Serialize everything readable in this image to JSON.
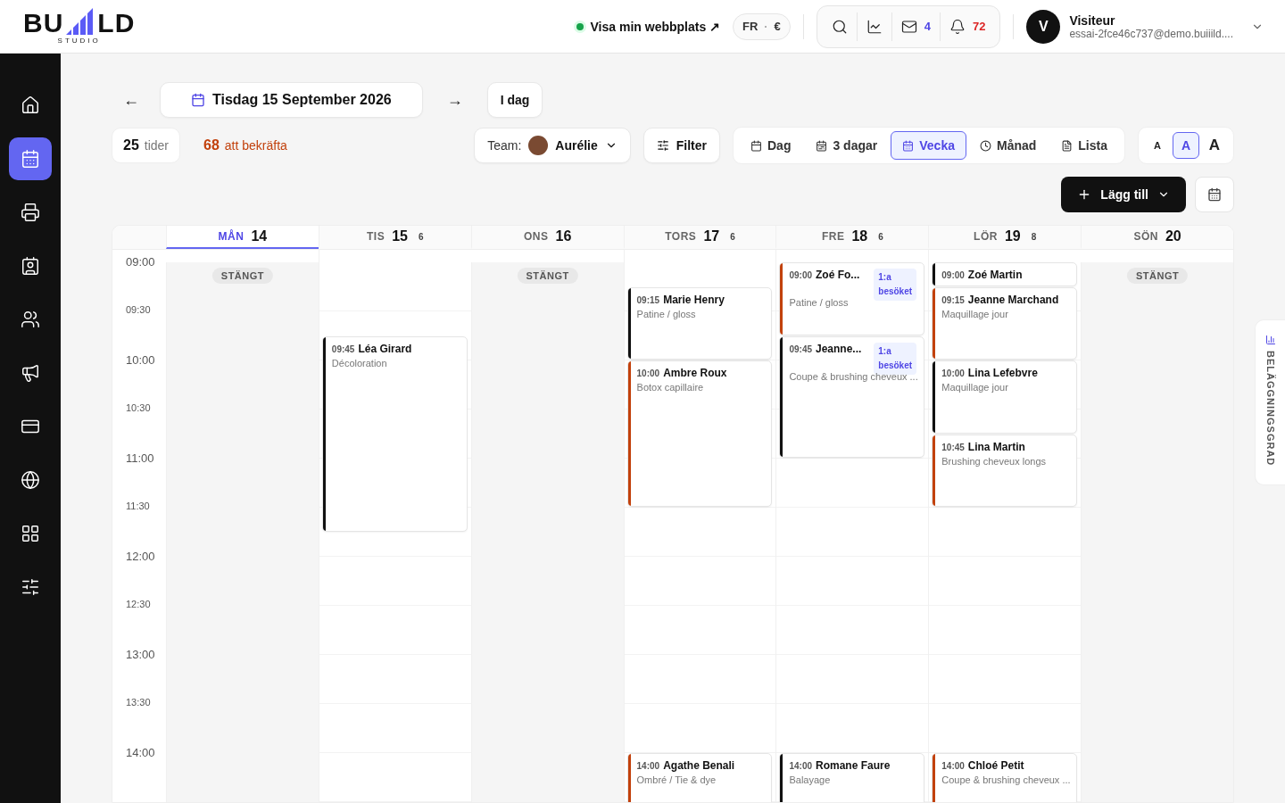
{
  "header": {
    "logo": {
      "left": "BU",
      "right": "LD",
      "sub": "STUDIO"
    },
    "site_link": {
      "label": "Visa min webbplats ↗",
      "online": true
    },
    "locale": {
      "language": "FR",
      "currency": "€"
    },
    "tools": [
      {
        "kind": "search"
      },
      {
        "kind": "stats"
      },
      {
        "kind": "mail",
        "count": "4"
      },
      {
        "kind": "bell",
        "count": "72"
      }
    ],
    "user": {
      "initial": "V",
      "name": "Visiteur",
      "email": "essai-2fce46c737@demo.buiiild...."
    }
  },
  "sidebar": {
    "items": [
      {
        "kind": "home",
        "selected": false
      },
      {
        "kind": "calendar",
        "selected": true
      },
      {
        "kind": "register",
        "selected": false
      },
      {
        "kind": "contacts",
        "selected": false
      },
      {
        "kind": "users",
        "selected": false
      },
      {
        "kind": "megaphone",
        "selected": false
      },
      {
        "kind": "card",
        "selected": false
      },
      {
        "kind": "globe",
        "selected": false
      },
      {
        "kind": "apps",
        "selected": false
      },
      {
        "kind": "sliders",
        "selected": false
      }
    ]
  },
  "date_nav": {
    "prev": "←",
    "date": "Tisdag 15 September 2026",
    "next": "→",
    "today": "I dag"
  },
  "stats": {
    "bookings": {
      "count": "25",
      "label": "tider"
    },
    "pending": {
      "count": "68",
      "label": "att bekräfta"
    }
  },
  "team": {
    "label": "Team:",
    "member": "Aurélie"
  },
  "filter": "Filter",
  "views": [
    {
      "kind": "day",
      "label": "Dag",
      "selected": false
    },
    {
      "kind": "three",
      "label": "3 dagar",
      "selected": false
    },
    {
      "kind": "week",
      "label": "Vecka",
      "selected": true
    },
    {
      "kind": "month",
      "label": "Månad",
      "selected": false
    },
    {
      "kind": "list",
      "label": "Lista",
      "selected": false
    }
  ],
  "font_sizes": [
    {
      "label": "A",
      "selected": false
    },
    {
      "label": "A",
      "selected": true
    },
    {
      "label": "A",
      "selected": false
    }
  ],
  "add_button": "Lägg till",
  "side_tab": "BELÄGGNINGSGRAD",
  "calendar": {
    "times": [
      "09:00",
      "09:30",
      "10:00",
      "10:30",
      "11:00",
      "11:30",
      "12:00",
      "12:30",
      "13:00",
      "13:30",
      "14:00"
    ],
    "days": [
      {
        "dow": "MÅN",
        "date": "14",
        "selected": true,
        "closed": true,
        "closed_label": "STÄNGT"
      },
      {
        "dow": "TIS",
        "date": "15",
        "count": "6",
        "selected": false,
        "closed": false,
        "events": [
          {
            "time": "09:45",
            "name": "Léa Girard",
            "service": "Décoloration",
            "color": "#111111"
          }
        ]
      },
      {
        "dow": "ONS",
        "date": "16",
        "selected": false,
        "closed": true,
        "closed_label": "STÄNGT"
      },
      {
        "dow": "TORS",
        "date": "17",
        "count": "6",
        "selected": false,
        "closed": false,
        "events": [
          {
            "time": "09:15",
            "name": "Marie Henry",
            "service": "Patine / gloss",
            "color": "#111111"
          },
          {
            "time": "10:00",
            "name": "Ambre Roux",
            "service": "Botox capillaire",
            "color": "#c2410c"
          },
          {
            "time": "14:00",
            "name": "Agathe Benali",
            "service": "Ombré / Tie & dye",
            "color": "#c2410c"
          }
        ]
      },
      {
        "dow": "FRE",
        "date": "18",
        "count": "6",
        "selected": false,
        "closed": false,
        "events": [
          {
            "time": "09:00",
            "name": "Zoé Fo...",
            "service": "Patine / gloss",
            "color": "#c2410c",
            "badge": "1:a besöket"
          },
          {
            "time": "09:45",
            "name": "Jeanne...",
            "service": "Coupe & brushing cheveux ...",
            "color": "#111111",
            "badge": "1:a besöket"
          },
          {
            "time": "14:00",
            "name": "Romane Faure",
            "service": "Balayage",
            "color": "#111111"
          }
        ]
      },
      {
        "dow": "LÖR",
        "date": "19",
        "count": "8",
        "selected": false,
        "closed": false,
        "events": [
          {
            "time": "09:00",
            "name": "Zoé Martin",
            "color": "#111111"
          },
          {
            "time": "09:15",
            "name": "Jeanne Marchand",
            "service": "Maquillage jour",
            "color": "#c2410c"
          },
          {
            "time": "10:00",
            "name": "Lina Lefebvre",
            "service": "Maquillage jour",
            "color": "#111111"
          },
          {
            "time": "10:45",
            "name": "Lina Martin",
            "service": "Brushing cheveux longs",
            "color": "#c2410c"
          },
          {
            "time": "14:00",
            "name": "Chloé Petit",
            "service": "Coupe & brushing cheveux ...",
            "color": "#c2410c"
          }
        ]
      },
      {
        "dow": "SÖN",
        "date": "20",
        "selected": false,
        "closed": true,
        "closed_label": "STÄNGT"
      }
    ]
  }
}
